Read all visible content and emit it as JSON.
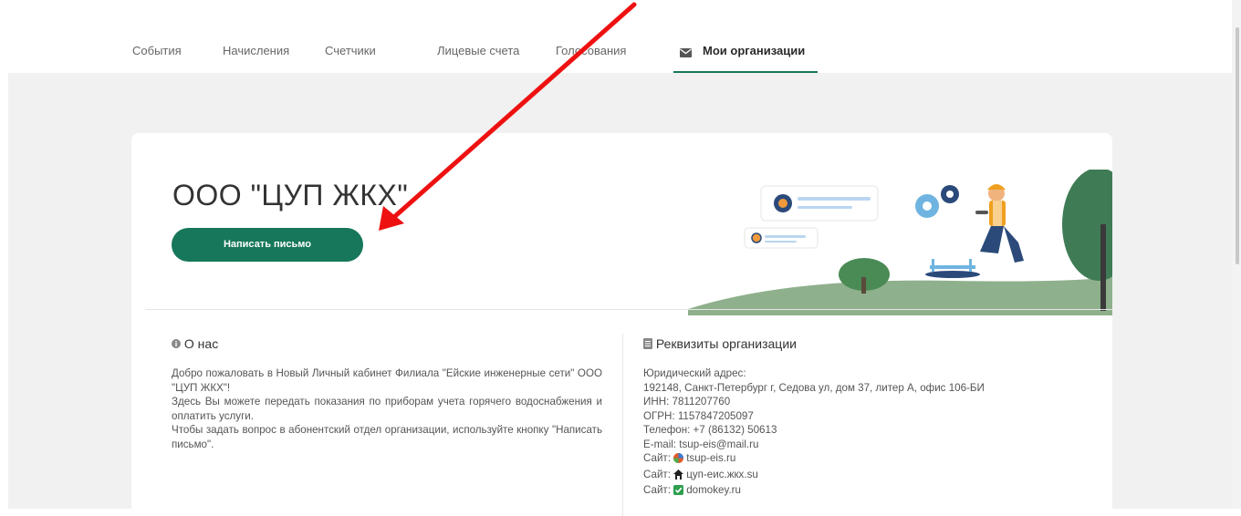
{
  "nav": {
    "items": [
      "События",
      "Начисления",
      "Счетчики",
      "Лицевые счета",
      "Голосования"
    ],
    "active": "Мои организации"
  },
  "org": {
    "title": "ООО \"ЦУП ЖКХ\"",
    "write_button": "Написать письмо"
  },
  "about": {
    "heading": "О нас",
    "lines": [
      "Добро пожаловать в Новый Личный кабинет Филиала \"Ейские инженерные сети\" ООО \"ЦУП ЖКХ\"!",
      "Здесь Вы можете передать показания по приборам учета горячего водоснабжения и оплатить услуги.",
      "Чтобы задать вопрос в абонентский отдел организации, используйте кнопку \"Написать письмо\"."
    ]
  },
  "requisites": {
    "heading": "Реквизиты организации",
    "legal_label": "Юридический адрес:",
    "address": "192148, Санкт-Петербург г, Седова ул, дом 37, литер А, офис 106-БИ",
    "inn": "ИНН: 7811207760",
    "ogrn": "ОГРН: 1157847205097",
    "phone": "Телефон: +7 (86132) 50613",
    "email": "E-mail: tsup-eis@mail.ru",
    "sites": [
      {
        "label": "Сайт:",
        "url": "tsup-eis.ru",
        "icon": "tsup-logo-icon"
      },
      {
        "label": "Сайт:",
        "url": "цуп-еис.жкх.su",
        "icon": "house-icon"
      },
      {
        "label": "Сайт:",
        "url": "domokey.ru",
        "icon": "domokey-logo-icon"
      }
    ]
  },
  "colors": {
    "accent": "#17775a",
    "annotation_arrow": "#ee1111",
    "page_bg": "#f1f1f1"
  }
}
